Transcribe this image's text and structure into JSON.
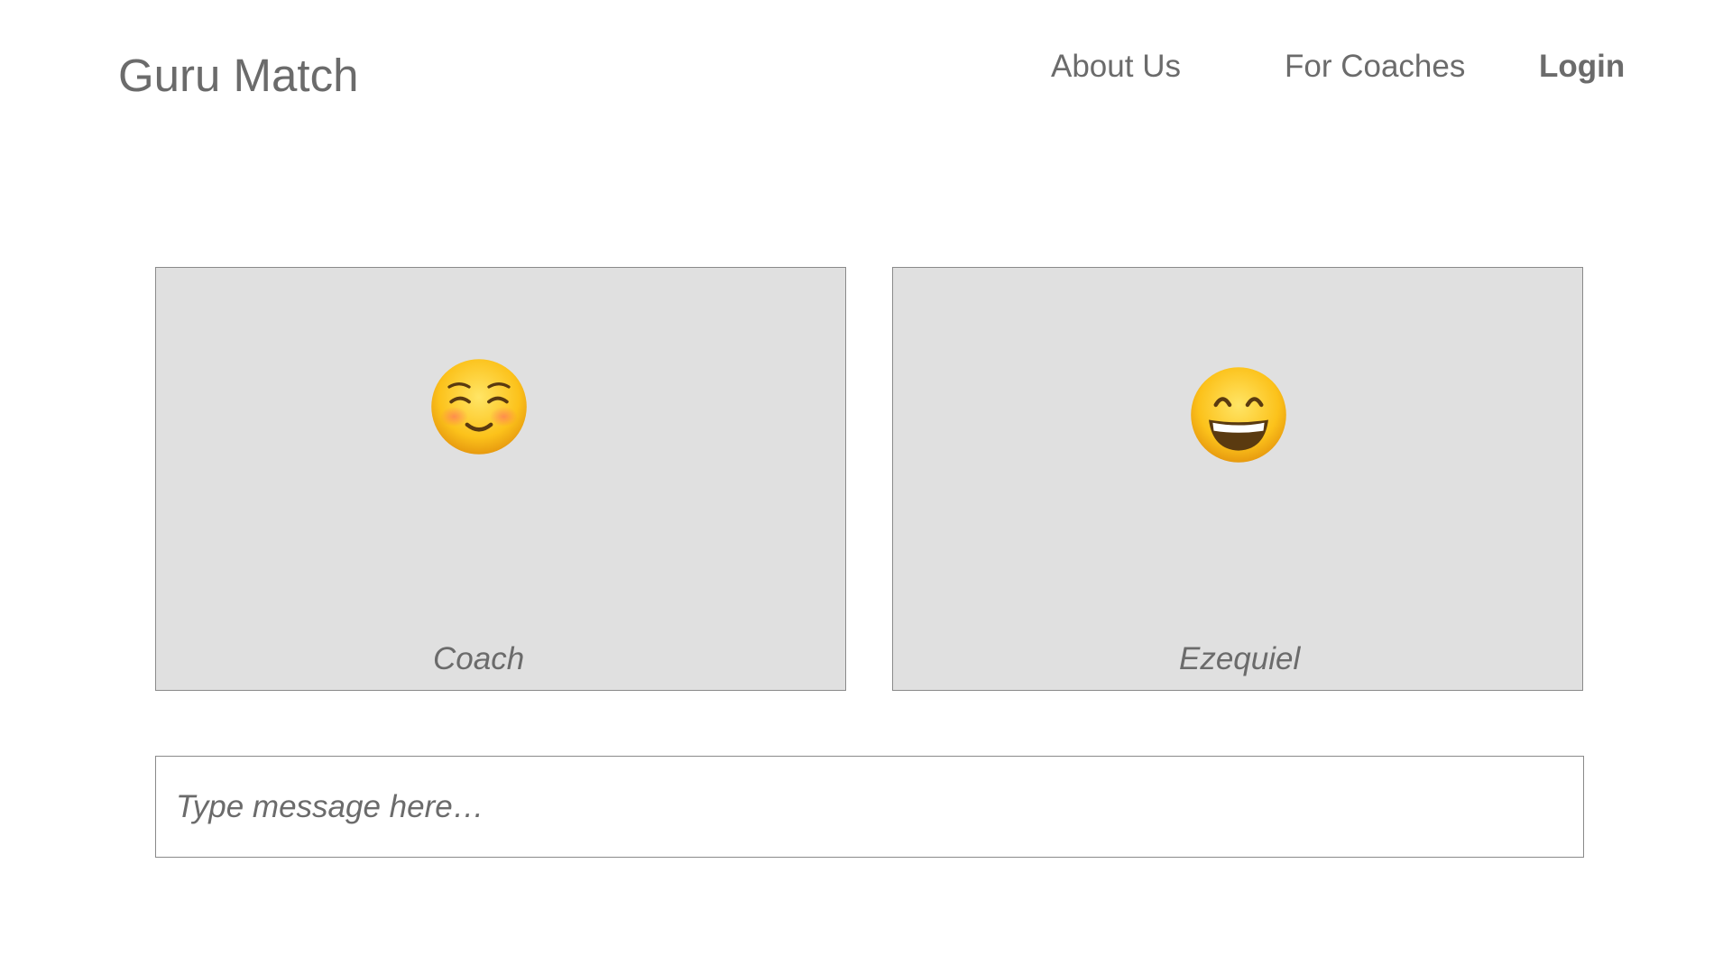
{
  "header": {
    "logo": "Guru Match",
    "nav": {
      "about": "About Us",
      "coaches": "For Coaches",
      "login": "Login"
    }
  },
  "video": {
    "participants": [
      {
        "name": "Coach",
        "avatar_icon": "smiling-face-with-smiling-eyes-emoji"
      },
      {
        "name": "Ezequiel",
        "avatar_icon": "grinning-face-with-smiling-eyes-emoji"
      }
    ]
  },
  "message": {
    "placeholder": "Type message here…",
    "value": ""
  },
  "colors": {
    "text": "#6b6b6b",
    "tile_background": "#e0e0e0",
    "border": "#8a8a8a",
    "emoji_yellow": "#fcc21b"
  }
}
